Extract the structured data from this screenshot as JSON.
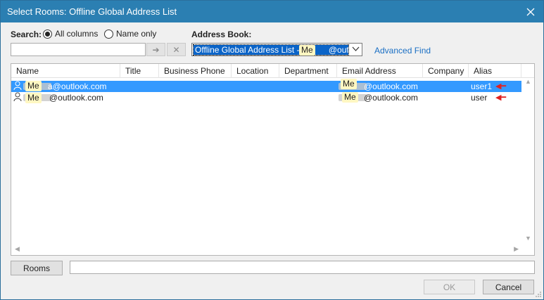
{
  "window": {
    "title": "Select Rooms: Offline Global Address List",
    "close_icon": "close-icon"
  },
  "search": {
    "label": "Search:",
    "options": [
      {
        "label": "All columns",
        "selected": true
      },
      {
        "label": "Name only",
        "selected": false
      }
    ],
    "value": "",
    "go_icon": "arrow-right-icon",
    "clear_icon": "clear-x-icon"
  },
  "address_book": {
    "label": "Address Book:",
    "selected": "Offline Global Address List - ",
    "selected_tail": "@outl",
    "advanced_find": "Advanced Find"
  },
  "columns": [
    "Name",
    "Title",
    "Business Phone",
    "Location",
    "Department",
    "Email Address",
    "Company",
    "Alias"
  ],
  "rows": [
    {
      "name": "a@outlook.com",
      "name_tag": "Me",
      "email": "@outlook.com",
      "email_tag": "Me",
      "alias": "user1",
      "selected": true
    },
    {
      "name": "@outlook.com",
      "name_tag": "Me",
      "email": "@outlook.com",
      "email_tag": "Me",
      "alias": "user",
      "selected": false
    }
  ],
  "footer": {
    "rooms_button": "Rooms",
    "rooms_value": "",
    "ok_button": "OK",
    "cancel_button": "Cancel"
  },
  "colors": {
    "titlebar": "#2b7fb2",
    "selection": "#3399ff",
    "link": "#1a6fc4",
    "annotation_arrow": "#e02020"
  }
}
